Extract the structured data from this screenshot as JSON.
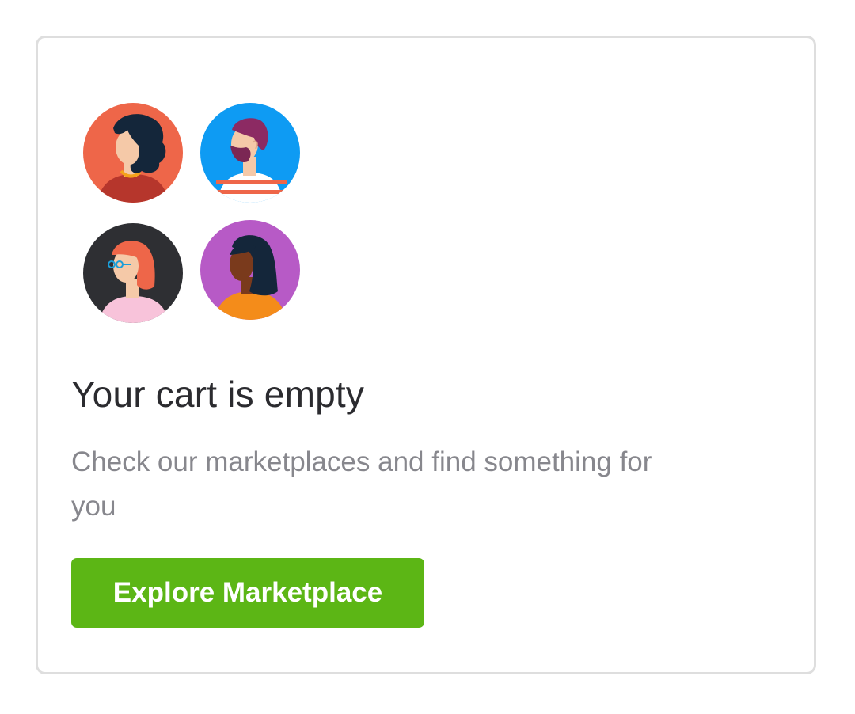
{
  "empty_cart": {
    "title": "Your cart is empty",
    "subtitle": "Check our marketplaces and find something for you",
    "button_label": "Explore Marketplace"
  },
  "avatars": [
    {
      "name": "woman-curly-hair-avatar",
      "background": "#ee6649"
    },
    {
      "name": "man-beard-avatar",
      "background": "#0e9bf3"
    },
    {
      "name": "woman-glasses-avatar",
      "background": "#2e2f33"
    },
    {
      "name": "woman-long-hair-avatar",
      "background": "#b75ac6"
    }
  ],
  "colors": {
    "accent": "#5cb615",
    "card_border": "#dedede",
    "title_text": "#2b2b2f",
    "subtitle_text": "#87878d"
  }
}
